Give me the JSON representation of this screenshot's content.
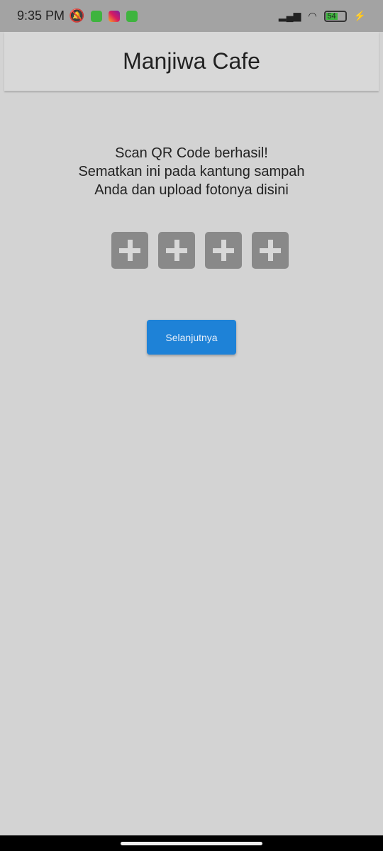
{
  "status_bar": {
    "time": "9:35 PM",
    "battery": "54",
    "colors": {
      "app1": "#3fb43f",
      "app3": "#3fb43f"
    }
  },
  "app_bar": {
    "title": "Manjiwa Cafe"
  },
  "message": {
    "line1": "Scan QR Code berhasil!",
    "line2": "Sematkan ini pada kantung sampah",
    "line3": "Anda dan upload fotonya disini"
  },
  "photo_slots": 4,
  "next_button": {
    "label": "Selanjutnya",
    "color": "#1e82d7"
  }
}
